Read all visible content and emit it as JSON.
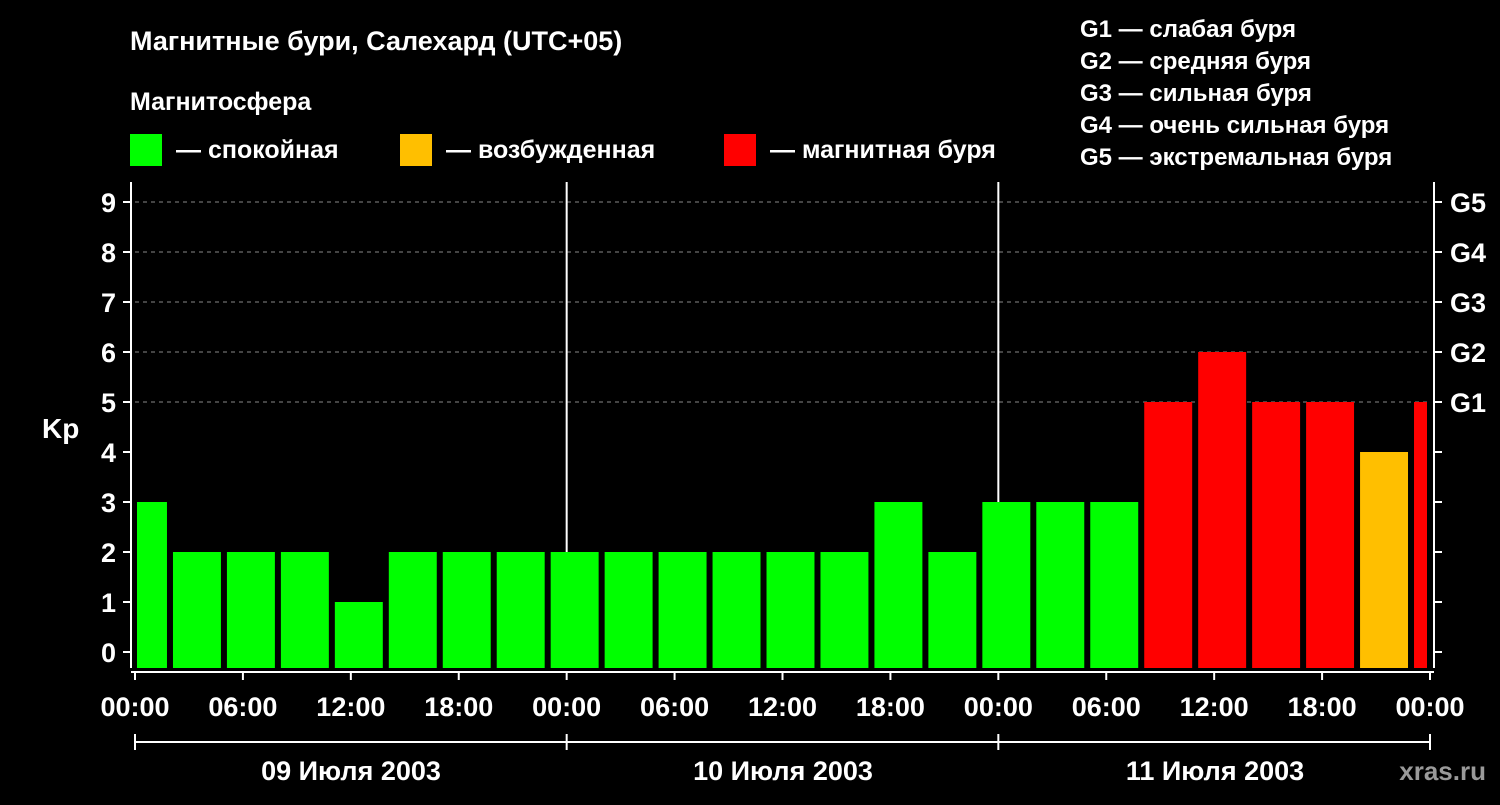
{
  "title": "Магнитные бури, Салехард (UTC+05)",
  "legend": {
    "heading": "Магнитосфера",
    "items": [
      {
        "label": "— спокойная",
        "color": "#00ff00"
      },
      {
        "label": "— возбужденная",
        "color": "#ffbf00"
      },
      {
        "label": "— магнитная буря",
        "color": "#ff0000"
      }
    ]
  },
  "g_scale_legend": [
    "G1 — слабая буря",
    "G2 — средняя буря",
    "G3 — сильная буря",
    "G4 — очень сильная буря",
    "G5 — экстремальная буря"
  ],
  "watermark": "xras.ru",
  "colors": {
    "background": "#000000",
    "quiet": "#00ff00",
    "disturbed": "#ffbf00",
    "storm": "#ff0000",
    "axis": "#ffffff",
    "grid": "#888888"
  },
  "chart_data": {
    "type": "bar",
    "title": "Магнитные бури, Салехард (UTC+05)",
    "ylabel": "Kp",
    "ylim": [
      0,
      9
    ],
    "y_ticks": [
      "0",
      "1",
      "2",
      "3",
      "4",
      "5",
      "6",
      "7",
      "8",
      "9"
    ],
    "right_ticks": [
      {
        "label": "G1",
        "value": 5
      },
      {
        "label": "G2",
        "value": 6
      },
      {
        "label": "G3",
        "value": 7
      },
      {
        "label": "G4",
        "value": 8
      },
      {
        "label": "G5",
        "value": 9
      }
    ],
    "x_tick_labels": [
      "00:00",
      "06:00",
      "12:00",
      "18:00",
      "00:00",
      "06:00",
      "12:00",
      "18:00",
      "00:00",
      "06:00",
      "12:00",
      "18:00",
      "00:00"
    ],
    "days": [
      "09 Июля 2003",
      "10 Июля 2003",
      "11 Июля 2003"
    ],
    "x_range_hours": [
      0,
      72
    ],
    "grid": "dashed horizontal at Kp 5-9",
    "bars": [
      {
        "start_hour": 0,
        "end_hour": 2,
        "kp": 3,
        "level": "quiet"
      },
      {
        "start_hour": 2,
        "end_hour": 5,
        "kp": 2,
        "level": "quiet"
      },
      {
        "start_hour": 5,
        "end_hour": 8,
        "kp": 2,
        "level": "quiet"
      },
      {
        "start_hour": 8,
        "end_hour": 11,
        "kp": 2,
        "level": "quiet"
      },
      {
        "start_hour": 11,
        "end_hour": 14,
        "kp": 1,
        "level": "quiet"
      },
      {
        "start_hour": 14,
        "end_hour": 17,
        "kp": 2,
        "level": "quiet"
      },
      {
        "start_hour": 17,
        "end_hour": 20,
        "kp": 2,
        "level": "quiet"
      },
      {
        "start_hour": 20,
        "end_hour": 23,
        "kp": 2,
        "level": "quiet"
      },
      {
        "start_hour": 23,
        "end_hour": 26,
        "kp": 2,
        "level": "quiet"
      },
      {
        "start_hour": 26,
        "end_hour": 29,
        "kp": 2,
        "level": "quiet"
      },
      {
        "start_hour": 29,
        "end_hour": 32,
        "kp": 2,
        "level": "quiet"
      },
      {
        "start_hour": 32,
        "end_hour": 35,
        "kp": 2,
        "level": "quiet"
      },
      {
        "start_hour": 35,
        "end_hour": 38,
        "kp": 2,
        "level": "quiet"
      },
      {
        "start_hour": 38,
        "end_hour": 41,
        "kp": 2,
        "level": "quiet"
      },
      {
        "start_hour": 41,
        "end_hour": 44,
        "kp": 3,
        "level": "quiet"
      },
      {
        "start_hour": 44,
        "end_hour": 47,
        "kp": 2,
        "level": "quiet"
      },
      {
        "start_hour": 47,
        "end_hour": 50,
        "kp": 3,
        "level": "quiet"
      },
      {
        "start_hour": 50,
        "end_hour": 53,
        "kp": 3,
        "level": "quiet"
      },
      {
        "start_hour": 53,
        "end_hour": 56,
        "kp": 3,
        "level": "quiet"
      },
      {
        "start_hour": 56,
        "end_hour": 59,
        "kp": 5,
        "level": "storm"
      },
      {
        "start_hour": 59,
        "end_hour": 62,
        "kp": 6,
        "level": "storm"
      },
      {
        "start_hour": 62,
        "end_hour": 65,
        "kp": 5,
        "level": "storm"
      },
      {
        "start_hour": 65,
        "end_hour": 68,
        "kp": 5,
        "level": "storm"
      },
      {
        "start_hour": 68,
        "end_hour": 71,
        "kp": 4,
        "level": "disturbed"
      },
      {
        "start_hour": 71,
        "end_hour": 72,
        "kp": 5,
        "level": "storm"
      }
    ]
  }
}
